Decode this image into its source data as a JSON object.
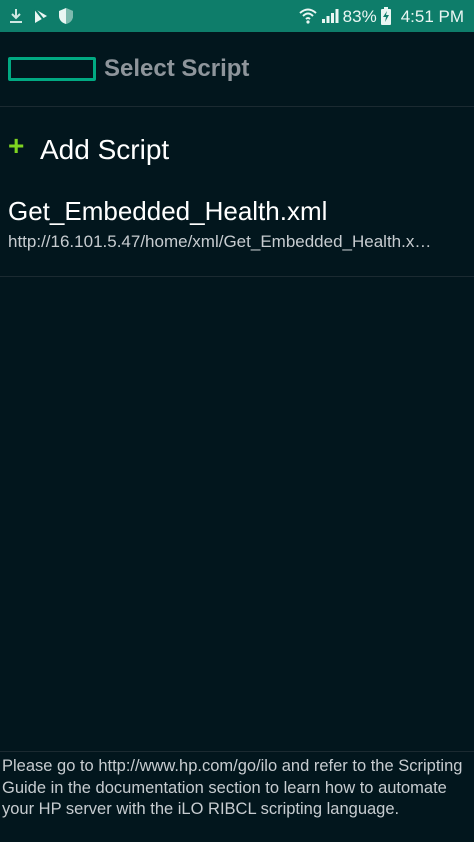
{
  "status_bar": {
    "battery": "83%",
    "time": "4:51 PM",
    "left_icons": [
      "download-icon",
      "play-store-icon",
      "shield-icon"
    ],
    "right_icons": [
      "wifi-icon",
      "signal-icon",
      "battery-charging-icon"
    ]
  },
  "header": {
    "logo": "hpe-logo",
    "title": "Select Script"
  },
  "list": {
    "add_label": "Add Script",
    "items": [
      {
        "name": "Get_Embedded_Health.xml",
        "url": "http://16.101.5.47/home/xml/Get_Embedded_Health.x…"
      }
    ]
  },
  "footer": {
    "note": "Please go to http://www.hp.com/go/ilo and refer to the Scripting Guide in the documentation section to learn how to automate your HP server with the iLO RIBCL scripting language."
  },
  "colors": {
    "background": "#02161d",
    "status_bar": "#0e7d6a",
    "accent": "#01a982",
    "plus": "#7ed321",
    "title": "#8e959b"
  }
}
